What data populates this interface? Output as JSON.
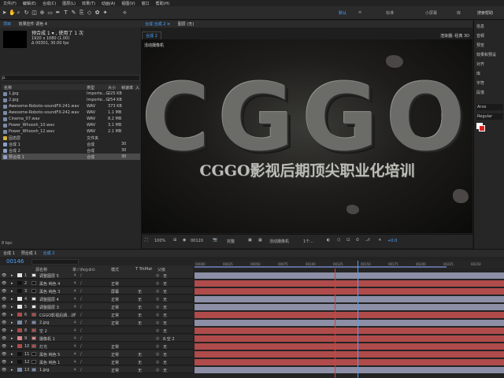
{
  "menu": [
    "文件(F)",
    "编辑(E)",
    "合成(C)",
    "图层(L)",
    "效果(T)",
    "动画(A)",
    "视图(V)",
    "窗口",
    "帮助(H)"
  ],
  "workspaces": {
    "active": "默认",
    "items": [
      "标准",
      "小屏幕",
      "库"
    ],
    "search": "搜索帮助"
  },
  "project": {
    "tabs": [
      "项目",
      "效果控件 调色 4"
    ],
    "item_name": "预合成 1 ▾ , 使用了 1 次",
    "item_size": "1920 x 1080 (1.00)",
    "item_duration": "Δ 00301, 30.00 fps",
    "search_placeholder": "ρ.",
    "headers": [
      "名称",
      "类型",
      "大小",
      "帧速率",
      "入"
    ],
    "rows": [
      {
        "name": "1.jpg",
        "type": "Importe...G",
        "size": "225 KB",
        "fps": "",
        "color": "#7a8aa8"
      },
      {
        "name": "2.jpg",
        "type": "Importe...G",
        "size": "254 KB",
        "fps": "",
        "color": "#7a8aa8"
      },
      {
        "name": "Awesome-Roboto-soundFX-241.wav",
        "type": "WAV",
        "size": "373 KB",
        "fps": "",
        "color": "#7a8aa8"
      },
      {
        "name": "Awesome-Roboto-soundFX-242.wav",
        "type": "WAV",
        "size": "1.1 MB",
        "fps": "",
        "color": "#7a8aa8"
      },
      {
        "name": "Cinema_07.wav",
        "type": "WAV",
        "size": "8.2 MB",
        "fps": "",
        "color": "#7a8aa8"
      },
      {
        "name": "Power_Whoosh_10.wav",
        "type": "WAV",
        "size": "3.1 MB",
        "fps": "",
        "color": "#7a8aa8"
      },
      {
        "name": "Power_Whoosh_12.wav",
        "type": "WAV",
        "size": "2.1 MB",
        "fps": "",
        "color": "#7a8aa8"
      },
      {
        "name": "固态层",
        "type": "文件夹",
        "size": "",
        "fps": "",
        "color": "#d6b23c"
      },
      {
        "name": "合成 1",
        "type": "合成",
        "size": "",
        "fps": "30",
        "color": "#8fa0c9"
      },
      {
        "name": "合成 2",
        "type": "合成",
        "size": "",
        "fps": "30",
        "color": "#8fa0c9"
      },
      {
        "name": "预合成 1",
        "type": "合成",
        "size": "",
        "fps": "30",
        "color": "#8fa0c9"
      }
    ],
    "footer": "8 bpc"
  },
  "viewer": {
    "tabs": [
      "合成 合成 2 ≡",
      "图层 (无)"
    ],
    "subtab": "合成 2",
    "renderer": "渲染器: 经典 3D",
    "active_camera": "活动摄像机",
    "headline": "CGGO",
    "subtitle": "CGGO影视后期顶尖职业化培训",
    "zoom": "100%",
    "timecode": "00120",
    "quality": "完整",
    "view_camera": "活动摄像机",
    "views": "1个...",
    "offset": "+0.0"
  },
  "right_panel": [
    "信息",
    "音频",
    "预览",
    "效果和预设",
    "对齐",
    "库",
    "字符",
    "段落"
  ],
  "right_font": "Arvo",
  "right_style": "Regular",
  "timeline": {
    "tabs": [
      "合成 1",
      "预合成 1",
      "合成 2"
    ],
    "timecode": "00146",
    "headers": [
      "源名称",
      "单☆\\fx◎⊘⊙",
      "模式",
      "T TrkMat",
      "父级"
    ],
    "ruler": [
      "00000",
      "00025",
      "00050",
      "00075",
      "00100",
      "00125",
      "00150",
      "00175",
      "00200",
      "00225",
      "00250"
    ],
    "layers": [
      {
        "n": "1",
        "name": "调整图层 5",
        "mode": "",
        "trk": "",
        "parent": "无",
        "color": "#e6e6e6",
        "bar": "#8c8fa6"
      },
      {
        "n": "2",
        "name": "黑色 纯色 4",
        "mode": "正常",
        "trk": "",
        "parent": "无",
        "color": "#111111",
        "bar": "#b04b4b"
      },
      {
        "n": "3",
        "name": "黑色 纯色 3",
        "mode": "屏幕",
        "trk": "无",
        "parent": "无",
        "color": "#111111",
        "bar": "#b04b4b"
      },
      {
        "n": "4",
        "name": "调整图层 4",
        "mode": "正常",
        "trk": "无",
        "parent": "无",
        "color": "#e6e6e6",
        "bar": "#8c8fa6"
      },
      {
        "n": "5",
        "name": "调整图层 3",
        "mode": "正常",
        "trk": "无",
        "parent": "无",
        "color": "#e6e6e6",
        "bar": "#8c8fa6"
      },
      {
        "n": "6",
        "name": "CGGO影视后期...训",
        "mode": "正常",
        "trk": "无",
        "parent": "无",
        "color": "#b04b4b",
        "bar": "#b04b4b"
      },
      {
        "n": "7",
        "name": "2.jpg",
        "mode": "正常",
        "trk": "无",
        "parent": "无",
        "color": "#7a8aa8",
        "bar": "#8c8fa6"
      },
      {
        "n": "8",
        "name": "空 2",
        "mode": "",
        "trk": "",
        "parent": "无",
        "color": "#b04b4b",
        "bar": "#b04b4b"
      },
      {
        "n": "9",
        "name": "摄像机 1",
        "mode": "",
        "trk": "",
        "parent": "8.空 2",
        "color": "#d88",
        "bar": "#b04b4b"
      },
      {
        "n": "10",
        "name": "灯光",
        "mode": "正常",
        "trk": "",
        "parent": "无",
        "color": "#b04b4b",
        "bar": "#b04b4b"
      },
      {
        "n": "11",
        "name": "黑色 纯色 5",
        "mode": "正常",
        "trk": "无",
        "parent": "无",
        "color": "#111111",
        "bar": "#b04b4b"
      },
      {
        "n": "12",
        "name": "黑色 纯色 1",
        "mode": "正常",
        "trk": "无",
        "parent": "无",
        "color": "#111111",
        "bar": "#b04b4b"
      },
      {
        "n": "13",
        "name": "1.jpg",
        "mode": "正常",
        "trk": "无",
        "parent": "无",
        "color": "#7a8aa8",
        "bar": "#8c8fa6"
      }
    ]
  },
  "colors": {
    "accent": "#4aa3ff",
    "playhead": "#4aa3ff",
    "work_area": "#5f6b9a"
  }
}
